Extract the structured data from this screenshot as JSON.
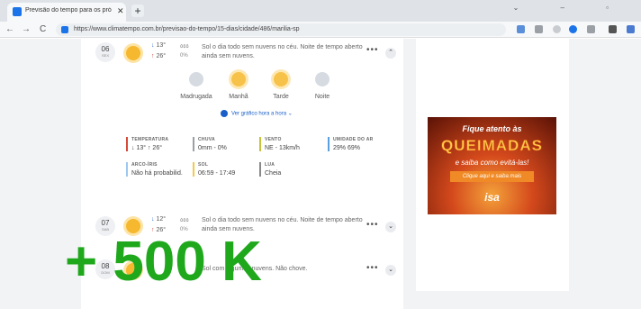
{
  "browser": {
    "tab_title": "Previsão do tempo para os pró...",
    "url": "https://www.climatempo.com.br/previsao-do-tempo/15-dias/cidade/486/marilia-sp"
  },
  "days": [
    {
      "day": "06",
      "weekday": "SEX",
      "min": "13°",
      "max": "26°",
      "rain_mm": "0%",
      "text": "Sol o dia todo sem nuvens no céu. Noite de tempo aberto ainda sem nuvens."
    },
    {
      "day": "07",
      "weekday": "SAB",
      "min": "12°",
      "max": "26°",
      "rain_mm": "0%",
      "text": "Sol o dia todo sem nuvens no céu. Noite de tempo aberto ainda sem nuvens."
    },
    {
      "day": "08",
      "weekday": "DOM",
      "text": "Sol com algumas nuvens. Não chove."
    }
  ],
  "periods": [
    "Madrugada",
    "Manhã",
    "Tarde",
    "Noite"
  ],
  "graph_link": "Ver gráfico hora a hora",
  "details": {
    "temperatura": {
      "title": "TEMPERATURA",
      "value": "↓ 13°   ↑ 26°"
    },
    "chuva": {
      "title": "CHUVA",
      "value": "0mm - 0%"
    },
    "vento": {
      "title": "VENTO",
      "value": "NE - 13km/h"
    },
    "umidade": {
      "title": "UMIDADE DO AR",
      "value": "29%   69%"
    },
    "arco_iris": {
      "title": "ARCO-ÍRIS",
      "value": "Não há probabilid."
    },
    "sol": {
      "title": "SOL",
      "value": "06:59 - 17:49"
    },
    "lua": {
      "title": "LUA",
      "value": "Cheia"
    }
  },
  "ad": {
    "line1": "Fique atento às",
    "line2": "QUEIMADAS",
    "line3": "e saiba como evitá-las!",
    "cta": "Clique aqui e saiba mais",
    "logo": "isa"
  },
  "overlay": "+ 500 K",
  "colors": {
    "temperatura": "#d64a3a",
    "chuva": "#9aa0a6",
    "vento": "#c7c23a",
    "umidade": "#5aa0e0",
    "arco_iris": "#9ec7f0",
    "sol": "#f2c94c",
    "lua": "#888888",
    "overlay": "#1fa81c"
  }
}
